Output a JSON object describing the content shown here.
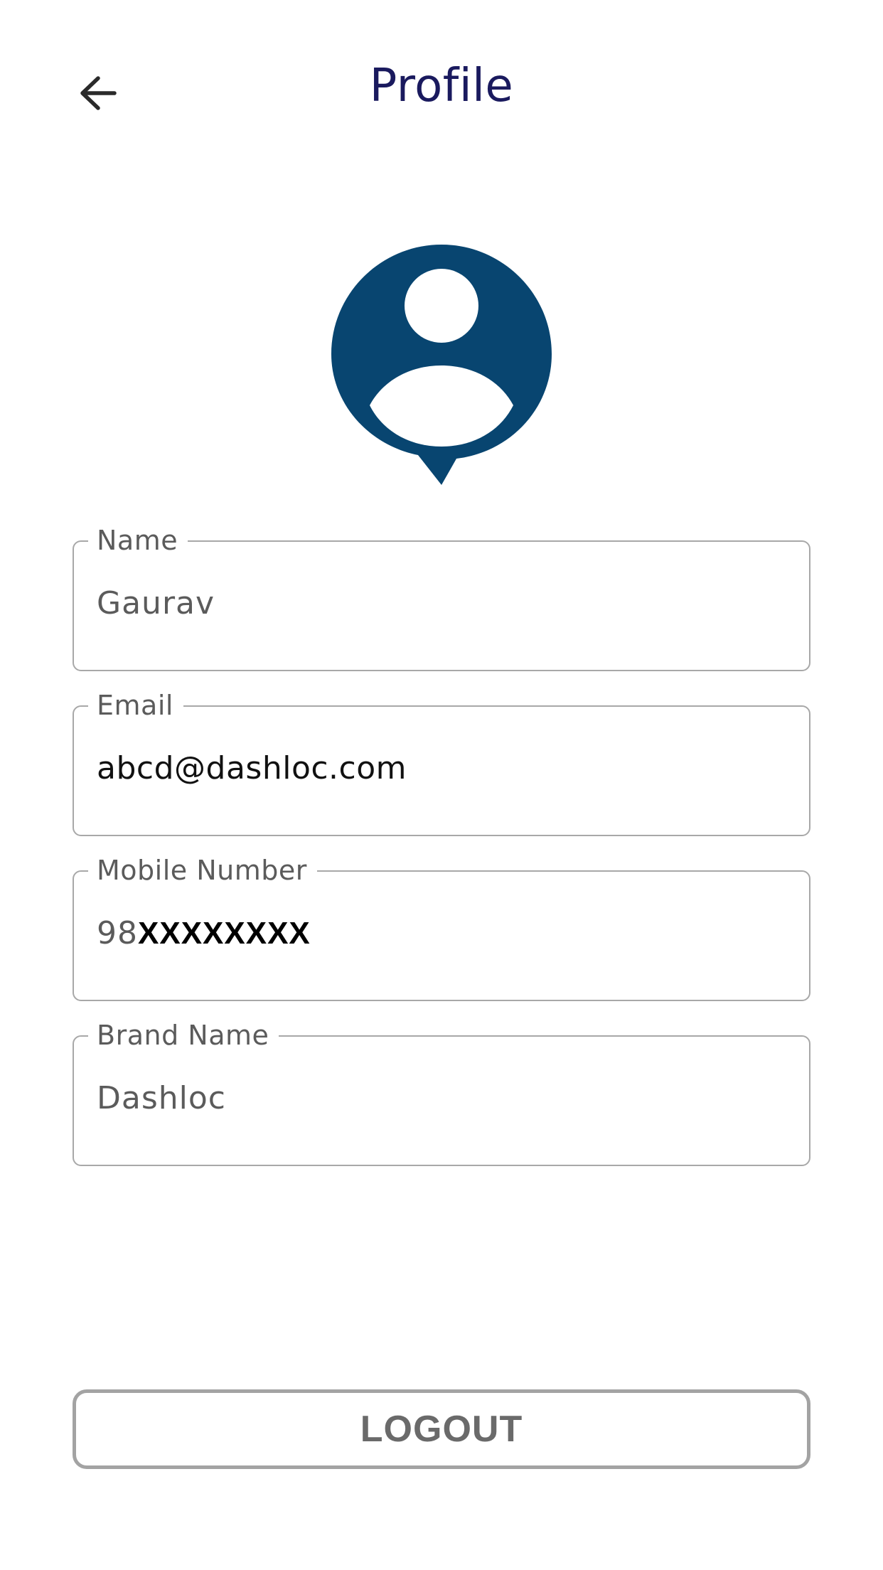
{
  "header": {
    "title": "Profile",
    "back_icon": "arrow-left-icon"
  },
  "avatar": {
    "icon": "user-location-pin-icon",
    "color": "#084570"
  },
  "fields": {
    "name": {
      "label": "Name",
      "value": "Gaurav"
    },
    "email": {
      "label": "Email",
      "value": "abcd@dashloc.com"
    },
    "mobile": {
      "label": "Mobile Number",
      "prefix": "98",
      "masked": "XXXXXXXX"
    },
    "brand": {
      "label": "Brand Name",
      "value": "Dashloc"
    }
  },
  "actions": {
    "logout_label": "LOGOUT"
  },
  "colors": {
    "title": "#1a1a5e",
    "border": "#a8a8a8",
    "label_text": "#5b5b5b"
  }
}
